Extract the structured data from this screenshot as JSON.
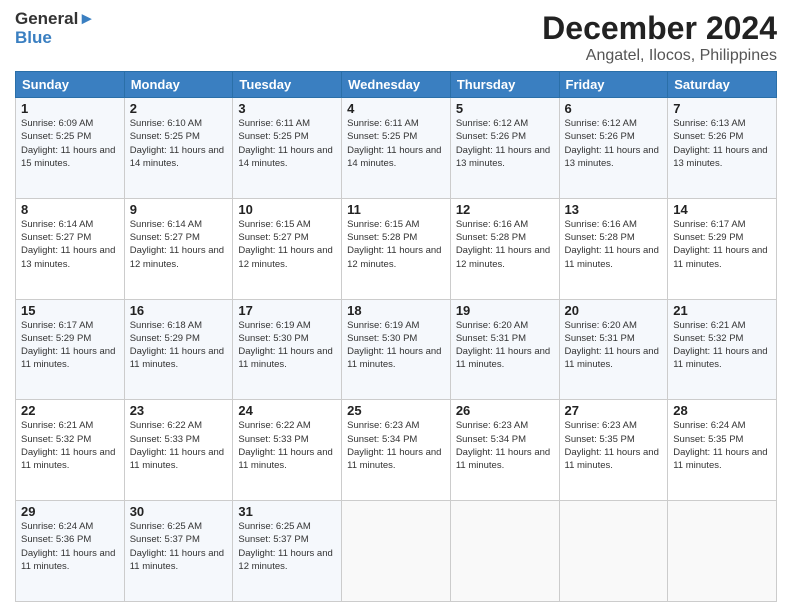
{
  "header": {
    "logo_general": "General",
    "logo_blue": "Blue",
    "title": "December 2024",
    "subtitle": "Angatel, Ilocos, Philippines"
  },
  "calendar": {
    "days_of_week": [
      "Sunday",
      "Monday",
      "Tuesday",
      "Wednesday",
      "Thursday",
      "Friday",
      "Saturday"
    ],
    "weeks": [
      [
        {
          "day": "1",
          "sunrise": "6:09 AM",
          "sunset": "5:25 PM",
          "daylight": "11 hours and 15 minutes."
        },
        {
          "day": "2",
          "sunrise": "6:10 AM",
          "sunset": "5:25 PM",
          "daylight": "11 hours and 14 minutes."
        },
        {
          "day": "3",
          "sunrise": "6:11 AM",
          "sunset": "5:25 PM",
          "daylight": "11 hours and 14 minutes."
        },
        {
          "day": "4",
          "sunrise": "6:11 AM",
          "sunset": "5:25 PM",
          "daylight": "11 hours and 14 minutes."
        },
        {
          "day": "5",
          "sunrise": "6:12 AM",
          "sunset": "5:26 PM",
          "daylight": "11 hours and 13 minutes."
        },
        {
          "day": "6",
          "sunrise": "6:12 AM",
          "sunset": "5:26 PM",
          "daylight": "11 hours and 13 minutes."
        },
        {
          "day": "7",
          "sunrise": "6:13 AM",
          "sunset": "5:26 PM",
          "daylight": "11 hours and 13 minutes."
        }
      ],
      [
        {
          "day": "8",
          "sunrise": "6:14 AM",
          "sunset": "5:27 PM",
          "daylight": "11 hours and 13 minutes."
        },
        {
          "day": "9",
          "sunrise": "6:14 AM",
          "sunset": "5:27 PM",
          "daylight": "11 hours and 12 minutes."
        },
        {
          "day": "10",
          "sunrise": "6:15 AM",
          "sunset": "5:27 PM",
          "daylight": "11 hours and 12 minutes."
        },
        {
          "day": "11",
          "sunrise": "6:15 AM",
          "sunset": "5:28 PM",
          "daylight": "11 hours and 12 minutes."
        },
        {
          "day": "12",
          "sunrise": "6:16 AM",
          "sunset": "5:28 PM",
          "daylight": "11 hours and 12 minutes."
        },
        {
          "day": "13",
          "sunrise": "6:16 AM",
          "sunset": "5:28 PM",
          "daylight": "11 hours and 11 minutes."
        },
        {
          "day": "14",
          "sunrise": "6:17 AM",
          "sunset": "5:29 PM",
          "daylight": "11 hours and 11 minutes."
        }
      ],
      [
        {
          "day": "15",
          "sunrise": "6:17 AM",
          "sunset": "5:29 PM",
          "daylight": "11 hours and 11 minutes."
        },
        {
          "day": "16",
          "sunrise": "6:18 AM",
          "sunset": "5:29 PM",
          "daylight": "11 hours and 11 minutes."
        },
        {
          "day": "17",
          "sunrise": "6:19 AM",
          "sunset": "5:30 PM",
          "daylight": "11 hours and 11 minutes."
        },
        {
          "day": "18",
          "sunrise": "6:19 AM",
          "sunset": "5:30 PM",
          "daylight": "11 hours and 11 minutes."
        },
        {
          "day": "19",
          "sunrise": "6:20 AM",
          "sunset": "5:31 PM",
          "daylight": "11 hours and 11 minutes."
        },
        {
          "day": "20",
          "sunrise": "6:20 AM",
          "sunset": "5:31 PM",
          "daylight": "11 hours and 11 minutes."
        },
        {
          "day": "21",
          "sunrise": "6:21 AM",
          "sunset": "5:32 PM",
          "daylight": "11 hours and 11 minutes."
        }
      ],
      [
        {
          "day": "22",
          "sunrise": "6:21 AM",
          "sunset": "5:32 PM",
          "daylight": "11 hours and 11 minutes."
        },
        {
          "day": "23",
          "sunrise": "6:22 AM",
          "sunset": "5:33 PM",
          "daylight": "11 hours and 11 minutes."
        },
        {
          "day": "24",
          "sunrise": "6:22 AM",
          "sunset": "5:33 PM",
          "daylight": "11 hours and 11 minutes."
        },
        {
          "day": "25",
          "sunrise": "6:23 AM",
          "sunset": "5:34 PM",
          "daylight": "11 hours and 11 minutes."
        },
        {
          "day": "26",
          "sunrise": "6:23 AM",
          "sunset": "5:34 PM",
          "daylight": "11 hours and 11 minutes."
        },
        {
          "day": "27",
          "sunrise": "6:23 AM",
          "sunset": "5:35 PM",
          "daylight": "11 hours and 11 minutes."
        },
        {
          "day": "28",
          "sunrise": "6:24 AM",
          "sunset": "5:35 PM",
          "daylight": "11 hours and 11 minutes."
        }
      ],
      [
        {
          "day": "29",
          "sunrise": "6:24 AM",
          "sunset": "5:36 PM",
          "daylight": "11 hours and 11 minutes."
        },
        {
          "day": "30",
          "sunrise": "6:25 AM",
          "sunset": "5:37 PM",
          "daylight": "11 hours and 11 minutes."
        },
        {
          "day": "31",
          "sunrise": "6:25 AM",
          "sunset": "5:37 PM",
          "daylight": "11 hours and 12 minutes."
        },
        null,
        null,
        null,
        null
      ]
    ]
  }
}
